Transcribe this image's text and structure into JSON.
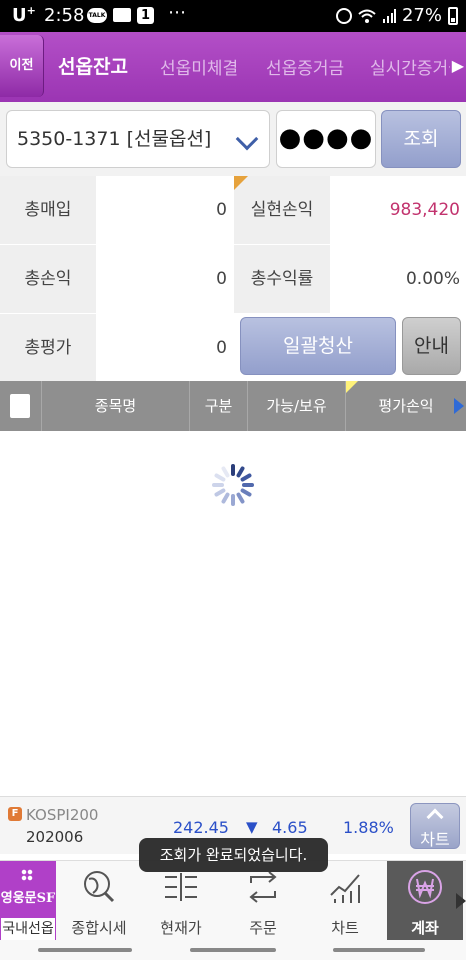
{
  "status_bar": {
    "carrier": "U",
    "carrier_sup": "+",
    "time": "2:58",
    "talk_badge": "TALK",
    "notif_count": "1",
    "more_dots": "⋯",
    "battery": "27%"
  },
  "header": {
    "back_label": "이전",
    "tabs": [
      {
        "label": "선옵잔고",
        "active": true
      },
      {
        "label": "선옵미체결",
        "active": false
      },
      {
        "label": "선옵증거금",
        "active": false
      },
      {
        "label": "실시간증거금",
        "active": false
      }
    ]
  },
  "account": {
    "selected": "5350-1371 [선물옵션]",
    "password_mask": "●●●●",
    "query_label": "조회"
  },
  "summary": {
    "total_buy_label": "총매입",
    "total_buy_value": "0",
    "realized_label": "실현손익",
    "realized_value": "983,420",
    "total_pl_label": "총손익",
    "total_pl_value": "0",
    "return_rate_label": "총수익률",
    "return_rate_value": "0.00%",
    "total_eval_label": "총평가",
    "total_eval_value": "0",
    "bulk_settle_label": "일괄청산",
    "guide_label": "안내"
  },
  "table": {
    "columns": [
      "종목명",
      "구분",
      "가능/보유",
      "평가손익"
    ],
    "rows": []
  },
  "ticker": {
    "badge": "F",
    "name": "KOSPI200",
    "code": "202006",
    "price": "242.45",
    "direction": "▼",
    "change": "4.65",
    "rate": "1.88%",
    "chart_label": "차트"
  },
  "toast": "조회가 완료되었습니다.",
  "bottom_nav": {
    "home_logo": "영웅문SF",
    "home_label": "국내선옵",
    "items": [
      {
        "label": "종합시세",
        "icon": "globe-search-icon"
      },
      {
        "label": "현재가",
        "icon": "price-ladder-icon"
      },
      {
        "label": "주문",
        "icon": "exchange-arrows-icon"
      },
      {
        "label": "차트",
        "icon": "line-chart-icon"
      },
      {
        "label": "계좌",
        "icon": "won-coin-icon",
        "active": true
      }
    ]
  },
  "colors": {
    "header": "#a43fbf",
    "button": "#a3acd6",
    "pink_value": "#c2336e",
    "blue_value": "#2b50c8"
  }
}
